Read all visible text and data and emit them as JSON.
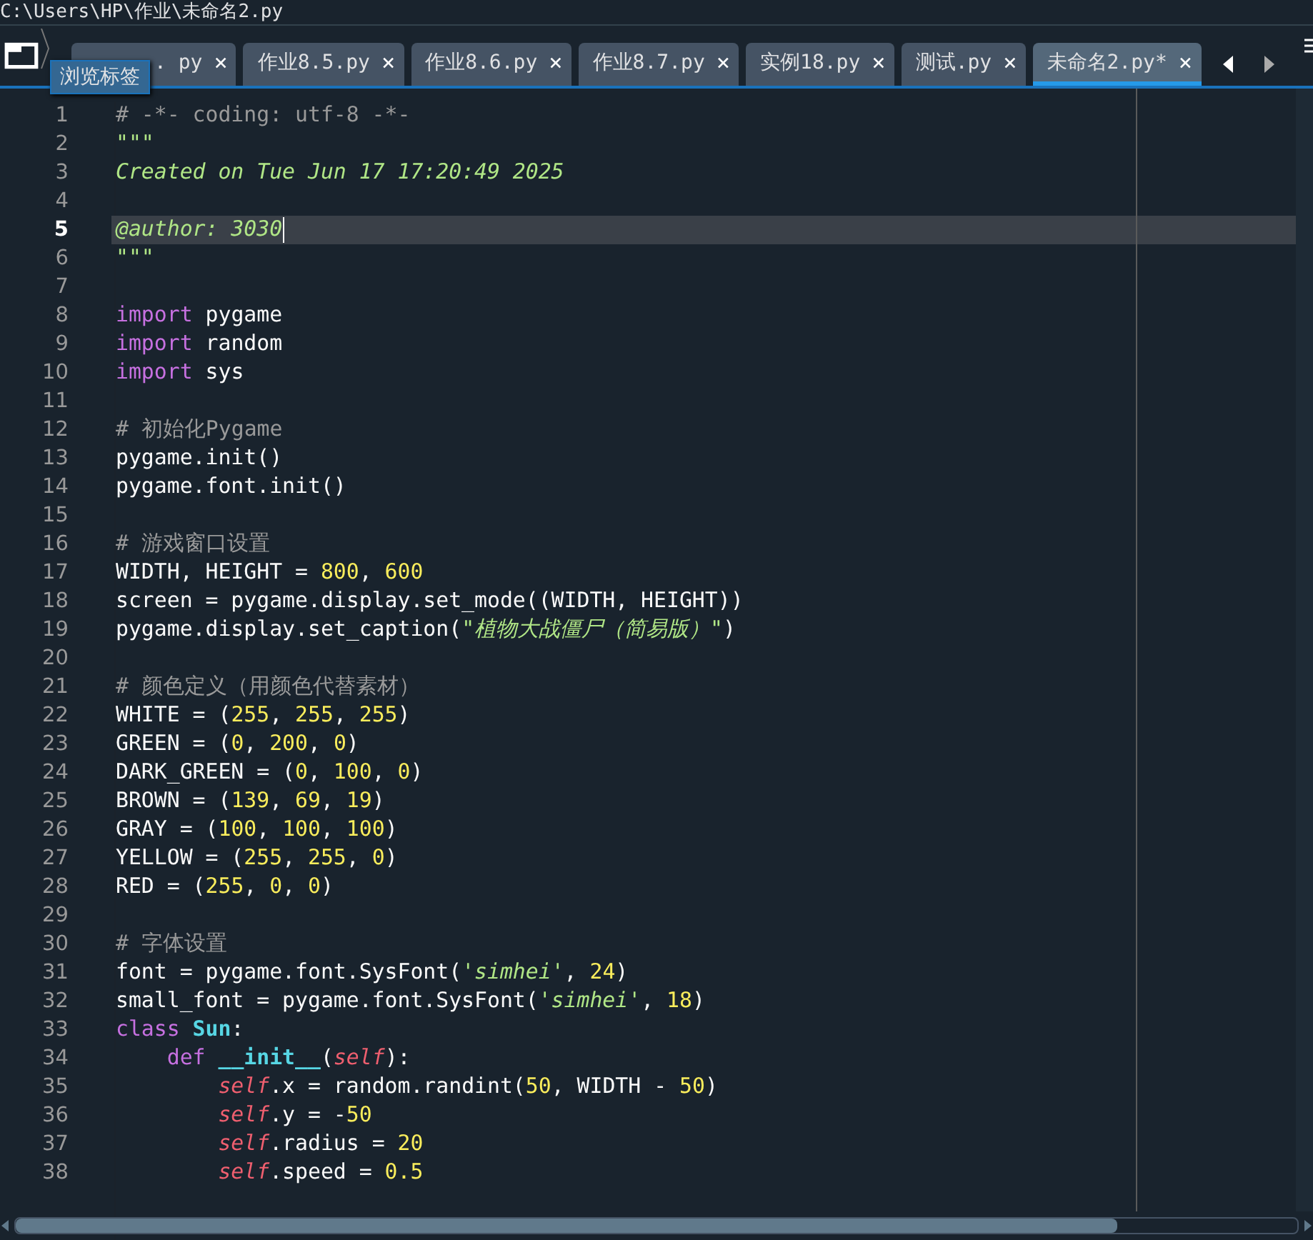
{
  "path_bar": {
    "text": "C:\\Users\\HP\\作业\\未命名2.py"
  },
  "tabs": [
    {
      "label": ". py",
      "selected": false
    },
    {
      "label": "作业8.5.py",
      "selected": false
    },
    {
      "label": "作业8.6.py",
      "selected": false
    },
    {
      "label": "作业8.7.py",
      "selected": false
    },
    {
      "label": "实例18.py",
      "selected": false
    },
    {
      "label": "测试.py",
      "selected": false
    },
    {
      "label": "未命名2.py*",
      "selected": true
    }
  ],
  "tooltip": {
    "text": "浏览标签"
  },
  "close_glyph": "×",
  "editor": {
    "lines": [
      {
        "number": "1",
        "current": false,
        "tokens": [
          {
            "kind": "comment",
            "text": "# -*- coding: utf-8 -*-"
          }
        ]
      },
      {
        "number": "2",
        "current": false,
        "tokens": [
          {
            "kind": "doc",
            "text": "\"\"\""
          }
        ]
      },
      {
        "number": "3",
        "current": false,
        "tokens": [
          {
            "kind": "doc",
            "text": "Created on Tue Jun 17 17:20:49 2025"
          }
        ]
      },
      {
        "number": "4",
        "current": false
      },
      {
        "number": "5",
        "current": true,
        "tokens": [
          {
            "kind": "doc",
            "text": "@author: 3030"
          }
        ]
      },
      {
        "number": "6",
        "current": false,
        "tokens": [
          {
            "kind": "doc",
            "text": "\"\"\""
          }
        ]
      },
      {
        "number": "7",
        "current": false
      },
      {
        "number": "8",
        "current": false,
        "tokens": [
          {
            "kind": "kw",
            "text": "import"
          },
          {
            "kind": "plain",
            "text": " pygame"
          }
        ]
      },
      {
        "number": "9",
        "current": false,
        "tokens": [
          {
            "kind": "kw",
            "text": "import"
          },
          {
            "kind": "plain",
            "text": " random"
          }
        ]
      },
      {
        "number": "10",
        "current": false,
        "tokens": [
          {
            "kind": "kw",
            "text": "import"
          },
          {
            "kind": "plain",
            "text": " sys"
          }
        ]
      },
      {
        "number": "11",
        "current": false
      },
      {
        "number": "12",
        "current": false,
        "tokens": [
          {
            "kind": "comment",
            "text": "# 初始化Pygame"
          }
        ]
      },
      {
        "number": "13",
        "current": false,
        "tokens": [
          {
            "kind": "plain",
            "text": "pygame.init()"
          }
        ]
      },
      {
        "number": "14",
        "current": false,
        "tokens": [
          {
            "kind": "plain",
            "text": "pygame.font.init()"
          }
        ]
      },
      {
        "number": "15",
        "current": false
      },
      {
        "number": "16",
        "current": false,
        "tokens": [
          {
            "kind": "comment",
            "text": "# 游戏窗口设置"
          }
        ]
      },
      {
        "number": "17",
        "current": false,
        "tokens": [
          {
            "kind": "plain",
            "text": "WIDTH, HEIGHT = "
          },
          {
            "kind": "num",
            "text": "800"
          },
          {
            "kind": "plain",
            "text": ", "
          },
          {
            "kind": "num",
            "text": "600"
          }
        ]
      },
      {
        "number": "18",
        "current": false,
        "tokens": [
          {
            "kind": "plain",
            "text": "screen = pygame.display.set_mode((WIDTH, HEIGHT))"
          }
        ]
      },
      {
        "number": "19",
        "current": false,
        "tokens": [
          {
            "kind": "plain",
            "text": "pygame.display.set_caption("
          },
          {
            "kind": "str",
            "text": "\"植物大战僵尸（简易版）\""
          },
          {
            "kind": "plain",
            "text": ")"
          }
        ]
      },
      {
        "number": "20",
        "current": false
      },
      {
        "number": "21",
        "current": false,
        "tokens": [
          {
            "kind": "comment",
            "text": "# 颜色定义（用颜色代替素材）"
          }
        ]
      },
      {
        "number": "22",
        "current": false,
        "tokens": [
          {
            "kind": "plain",
            "text": "WHITE = ("
          },
          {
            "kind": "num",
            "text": "255"
          },
          {
            "kind": "plain",
            "text": ", "
          },
          {
            "kind": "num",
            "text": "255"
          },
          {
            "kind": "plain",
            "text": ", "
          },
          {
            "kind": "num",
            "text": "255"
          },
          {
            "kind": "plain",
            "text": ")"
          }
        ]
      },
      {
        "number": "23",
        "current": false,
        "tokens": [
          {
            "kind": "plain",
            "text": "GREEN = ("
          },
          {
            "kind": "num",
            "text": "0"
          },
          {
            "kind": "plain",
            "text": ", "
          },
          {
            "kind": "num",
            "text": "200"
          },
          {
            "kind": "plain",
            "text": ", "
          },
          {
            "kind": "num",
            "text": "0"
          },
          {
            "kind": "plain",
            "text": ")"
          }
        ]
      },
      {
        "number": "24",
        "current": false,
        "tokens": [
          {
            "kind": "plain",
            "text": "DARK_GREEN = ("
          },
          {
            "kind": "num",
            "text": "0"
          },
          {
            "kind": "plain",
            "text": ", "
          },
          {
            "kind": "num",
            "text": "100"
          },
          {
            "kind": "plain",
            "text": ", "
          },
          {
            "kind": "num",
            "text": "0"
          },
          {
            "kind": "plain",
            "text": ")"
          }
        ]
      },
      {
        "number": "25",
        "current": false,
        "tokens": [
          {
            "kind": "plain",
            "text": "BROWN = ("
          },
          {
            "kind": "num",
            "text": "139"
          },
          {
            "kind": "plain",
            "text": ", "
          },
          {
            "kind": "num",
            "text": "69"
          },
          {
            "kind": "plain",
            "text": ", "
          },
          {
            "kind": "num",
            "text": "19"
          },
          {
            "kind": "plain",
            "text": ")"
          }
        ]
      },
      {
        "number": "26",
        "current": false,
        "tokens": [
          {
            "kind": "plain",
            "text": "GRAY = ("
          },
          {
            "kind": "num",
            "text": "100"
          },
          {
            "kind": "plain",
            "text": ", "
          },
          {
            "kind": "num",
            "text": "100"
          },
          {
            "kind": "plain",
            "text": ", "
          },
          {
            "kind": "num",
            "text": "100"
          },
          {
            "kind": "plain",
            "text": ")"
          }
        ]
      },
      {
        "number": "27",
        "current": false,
        "tokens": [
          {
            "kind": "plain",
            "text": "YELLOW = ("
          },
          {
            "kind": "num",
            "text": "255"
          },
          {
            "kind": "plain",
            "text": ", "
          },
          {
            "kind": "num",
            "text": "255"
          },
          {
            "kind": "plain",
            "text": ", "
          },
          {
            "kind": "num",
            "text": "0"
          },
          {
            "kind": "plain",
            "text": ")"
          }
        ]
      },
      {
        "number": "28",
        "current": false,
        "tokens": [
          {
            "kind": "plain",
            "text": "RED = ("
          },
          {
            "kind": "num",
            "text": "255"
          },
          {
            "kind": "plain",
            "text": ", "
          },
          {
            "kind": "num",
            "text": "0"
          },
          {
            "kind": "plain",
            "text": ", "
          },
          {
            "kind": "num",
            "text": "0"
          },
          {
            "kind": "plain",
            "text": ")"
          }
        ]
      },
      {
        "number": "29",
        "current": false
      },
      {
        "number": "30",
        "current": false,
        "tokens": [
          {
            "kind": "comment",
            "text": "# 字体设置"
          }
        ]
      },
      {
        "number": "31",
        "current": false,
        "tokens": [
          {
            "kind": "plain",
            "text": "font = pygame.font.SysFont("
          },
          {
            "kind": "str",
            "text": "'simhei'"
          },
          {
            "kind": "plain",
            "text": ", "
          },
          {
            "kind": "num",
            "text": "24"
          },
          {
            "kind": "plain",
            "text": ")"
          }
        ]
      },
      {
        "number": "32",
        "current": false,
        "tokens": [
          {
            "kind": "plain",
            "text": "small_font = pygame.font.SysFont("
          },
          {
            "kind": "str",
            "text": "'simhei'"
          },
          {
            "kind": "plain",
            "text": ", "
          },
          {
            "kind": "num",
            "text": "18"
          },
          {
            "kind": "plain",
            "text": ")"
          }
        ]
      },
      {
        "number": "33",
        "current": false,
        "tokens": [
          {
            "kind": "kw",
            "text": "class "
          },
          {
            "kind": "name",
            "text": "Sun"
          },
          {
            "kind": "plain",
            "text": ":"
          }
        ]
      },
      {
        "number": "34",
        "current": false,
        "tokens": [
          {
            "kind": "def",
            "text": "    def "
          },
          {
            "kind": "name",
            "text": "__init__"
          },
          {
            "kind": "plain",
            "text": "("
          },
          {
            "kind": "self",
            "text": "self"
          },
          {
            "kind": "plain",
            "text": "):"
          }
        ]
      },
      {
        "number": "35",
        "current": false,
        "tokens": [
          {
            "kind": "self",
            "text": "        self"
          },
          {
            "kind": "plain",
            "text": ".x = random.randint("
          },
          {
            "kind": "num",
            "text": "50"
          },
          {
            "kind": "plain",
            "text": ", WIDTH - "
          },
          {
            "kind": "num",
            "text": "50"
          },
          {
            "kind": "plain",
            "text": ")"
          }
        ]
      },
      {
        "number": "36",
        "current": false,
        "tokens": [
          {
            "kind": "self",
            "text": "        self"
          },
          {
            "kind": "plain",
            "text": ".y = -"
          },
          {
            "kind": "num",
            "text": "50"
          }
        ]
      },
      {
        "number": "37",
        "current": false,
        "tokens": [
          {
            "kind": "self",
            "text": "        self"
          },
          {
            "kind": "plain",
            "text": ".radius = "
          },
          {
            "kind": "num",
            "text": "20"
          }
        ]
      },
      {
        "number": "38",
        "current": false,
        "tokens": [
          {
            "kind": "self",
            "text": "        self"
          },
          {
            "kind": "plain",
            "text": ".speed = "
          },
          {
            "kind": "num",
            "text": "0.5"
          }
        ]
      }
    ]
  }
}
